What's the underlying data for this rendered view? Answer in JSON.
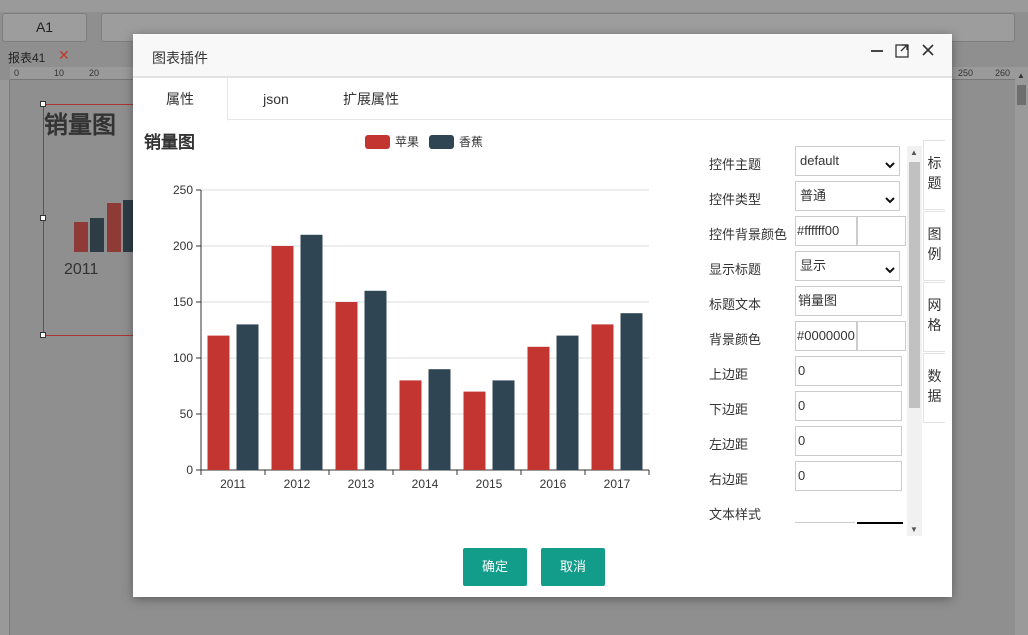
{
  "background": {
    "cell_ref": "A1",
    "sheet_tab": "报表41",
    "sheet_close": "✕",
    "ruler_ticks": [
      "0",
      "10",
      "20",
      "250",
      "260"
    ],
    "widget_title": "销量图",
    "widget_year": "2011"
  },
  "dialog": {
    "title": "图表插件",
    "tabs": [
      "属性",
      "json",
      "扩展属性"
    ],
    "confirm_label": "确定",
    "cancel_label": "取消"
  },
  "form": {
    "rows": [
      {
        "label": "控件主题",
        "type": "select",
        "value": "default"
      },
      {
        "label": "控件类型",
        "type": "select",
        "value": "普通"
      },
      {
        "label": "控件背景颜色",
        "type": "color",
        "value": "#ffffff00"
      },
      {
        "label": "显示标题",
        "type": "select",
        "value": "显示"
      },
      {
        "label": "标题文本",
        "type": "text",
        "value": "销量图"
      },
      {
        "label": "背景颜色",
        "type": "color",
        "value": "#0000000"
      },
      {
        "label": "上边距",
        "type": "text",
        "value": "0"
      },
      {
        "label": "下边距",
        "type": "text",
        "value": "0"
      },
      {
        "label": "左边距",
        "type": "text",
        "value": "0"
      },
      {
        "label": "右边距",
        "type": "text",
        "value": "0"
      },
      {
        "label": "文本样式",
        "type": "label",
        "value": ""
      }
    ]
  },
  "side_tabs": [
    {
      "chars": [
        "标",
        "题"
      ]
    },
    {
      "chars": [
        "图",
        "例"
      ]
    },
    {
      "chars": [
        "网",
        "格"
      ]
    },
    {
      "chars": [
        "数",
        "据"
      ]
    }
  ],
  "colors": {
    "apple": "#c23531",
    "banana": "#2f4554",
    "primary_button": "#129c8a"
  },
  "chart_data": {
    "type": "bar",
    "title": "销量图",
    "categories": [
      "2011",
      "2012",
      "2013",
      "2014",
      "2015",
      "2016",
      "2017"
    ],
    "series": [
      {
        "name": "苹果",
        "values": [
          120,
          200,
          150,
          80,
          70,
          110,
          130
        ]
      },
      {
        "name": "香蕉",
        "values": [
          130,
          210,
          160,
          90,
          80,
          120,
          140
        ]
      }
    ],
    "ylim": [
      0,
      250
    ],
    "yticks": [
      "0",
      "50",
      "100",
      "150",
      "200",
      "250"
    ],
    "grid": true,
    "legend": "top-center"
  }
}
